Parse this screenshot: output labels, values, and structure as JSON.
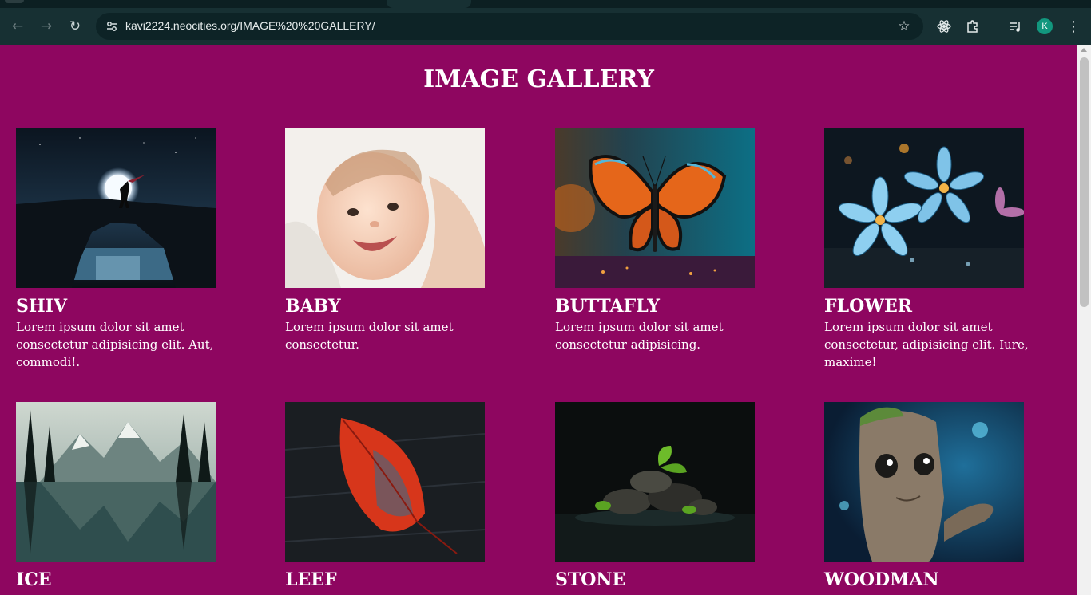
{
  "browser": {
    "url": "kavi2224.neocities.org/IMAGE%20%20GALLERY/",
    "profile_initial": "K",
    "icons": {
      "back": "arrow-left-icon",
      "forward": "arrow-right-icon",
      "reload": "reload-icon",
      "site_info": "tune-icon",
      "bookmark": "star-icon",
      "extension_react": "atom-icon",
      "extensions": "puzzle-icon",
      "media": "playlist-icon",
      "menu": "kebab-menu-icon"
    }
  },
  "page": {
    "background": "#8e0660",
    "title": "IMAGE GALLERY"
  },
  "gallery": [
    {
      "name": "SHIV",
      "description": "Lorem ipsum dolor sit amet consectetur adipisicing elit. Aut, commodi!."
    },
    {
      "name": "BABY",
      "description": "Lorem ipsum dolor sit amet consectetur."
    },
    {
      "name": "BUTTAFLY",
      "description": "Lorem ipsum dolor sit amet consectetur adipisicing."
    },
    {
      "name": "FLOWER",
      "description": "Lorem ipsum dolor sit amet consectetur, adipisicing elit. Iure, maxime!"
    },
    {
      "name": "ICE",
      "description": ""
    },
    {
      "name": "LEEF",
      "description": ""
    },
    {
      "name": "STONE",
      "description": ""
    },
    {
      "name": "WOODMAN",
      "description": ""
    }
  ]
}
